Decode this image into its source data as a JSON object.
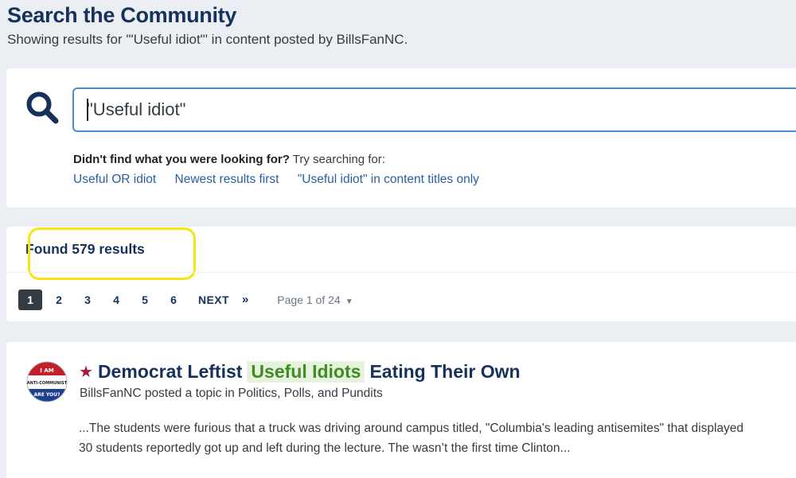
{
  "header": {
    "title": "Search the Community",
    "subtitle": "Showing results for '\"Useful idiot\"' in content posted by BillsFanNC."
  },
  "search": {
    "value": "\"Useful idiot\"",
    "suggest_bold": "Didn't find what you were looking for?",
    "suggest_rest": " Try searching for:",
    "links": [
      "Useful OR idiot",
      "Newest results first",
      "\"Useful idiot\" in content titles only"
    ]
  },
  "results": {
    "found_text": "Found 579 results",
    "pages": [
      "1",
      "2",
      "3",
      "4",
      "5",
      "6"
    ],
    "next_label": "NEXT",
    "last_label": "»",
    "page_jump": "Page 1 of 24",
    "highlight_color": "#f5e514"
  },
  "topic": {
    "avatar_text": [
      "I AM",
      "ANTI-COMMUNIST",
      "ARE YOU?"
    ],
    "title_before": "Democrat Leftist",
    "title_highlight": "Useful Idiots",
    "title_after": "Eating Their Own",
    "meta": "BillsFanNC posted a topic in Politics, Polls, and Pundits",
    "snippet_line1": "...The students were furious that a truck was driving around campus titled, \"Columbia's leading antisemites\" that displayed",
    "snippet_line2": "30 students reportedly got up and left during the lecture. The wasn’t the first time Clinton..."
  },
  "colors": {
    "brand": "#16325c",
    "link": "#2a5f9e",
    "featured_star": "#a8193d",
    "match_highlight_bg": "#e6f2dc",
    "match_highlight_fg": "#3d8d22"
  }
}
